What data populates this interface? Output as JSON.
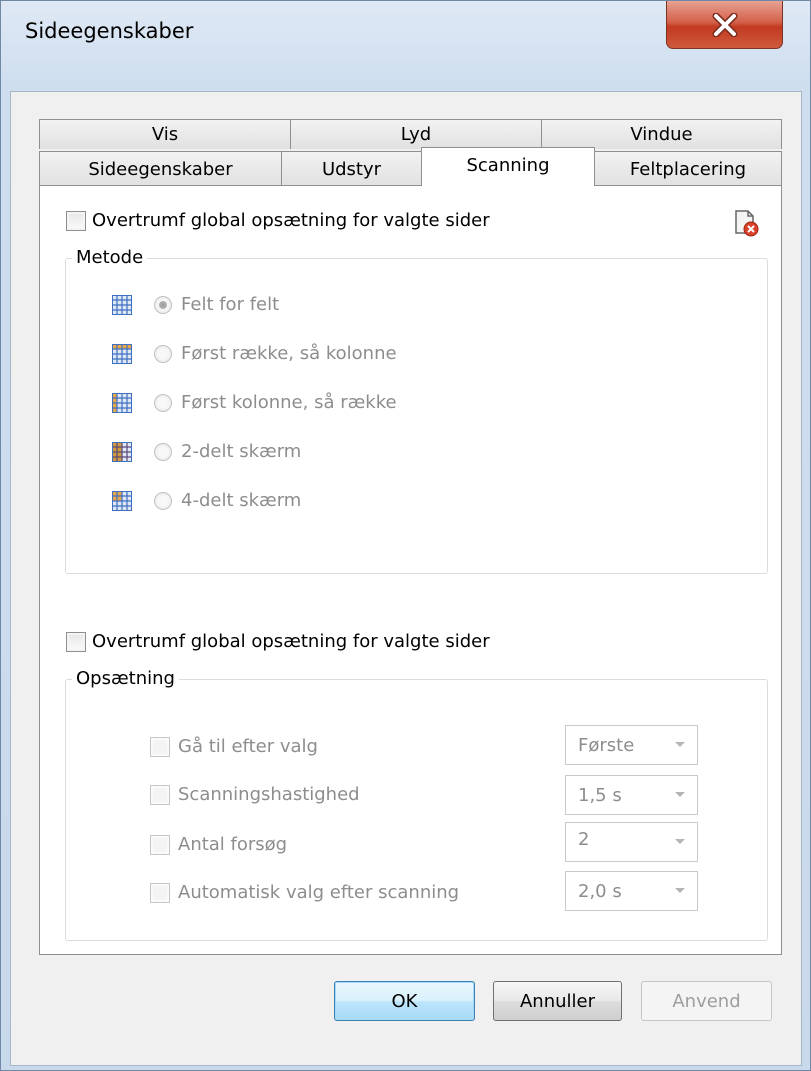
{
  "window": {
    "title": "Sideegenskaber"
  },
  "tabs": {
    "row1": [
      {
        "label": "Vis"
      },
      {
        "label": "Lyd"
      },
      {
        "label": "Vindue"
      }
    ],
    "row2": [
      {
        "label": "Sideegenskaber"
      },
      {
        "label": "Udstyr"
      },
      {
        "label": "Scanning"
      },
      {
        "label": "Feltplacering"
      }
    ],
    "active": "Scanning"
  },
  "method_section": {
    "override_label": "Overtrumf global opsætning for valgte sider",
    "override_checked": false,
    "group_title": "Metode",
    "options": [
      {
        "label": "Felt for felt",
        "checked": true,
        "icon": "grid-blue-icon"
      },
      {
        "label": "Først række, så kolonne",
        "checked": false,
        "icon": "grid-row-icon"
      },
      {
        "label": "Først kolonne, så række",
        "checked": false,
        "icon": "grid-column-icon"
      },
      {
        "label": "2-delt skærm",
        "checked": false,
        "icon": "grid-split2-icon"
      },
      {
        "label": "4-delt skærm",
        "checked": false,
        "icon": "grid-split4-icon"
      }
    ]
  },
  "setup_section": {
    "override_label": "Overtrumf global opsætning for valgte sider",
    "override_checked": false,
    "group_title": "Opsætning",
    "settings": [
      {
        "label": "Gå til efter valg",
        "value": "Første"
      },
      {
        "label": "Scanningshastighed",
        "value": "1,5 s"
      },
      {
        "label": "Antal forsøg",
        "value": "2"
      },
      {
        "label": "Automatisk valg efter scanning",
        "value": "2,0 s"
      }
    ]
  },
  "buttons": {
    "ok": "OK",
    "cancel": "Annuller",
    "apply": "Anvend"
  },
  "colors": {
    "close_red": "#c23a21",
    "grid_blue": "#3f6fc0",
    "grid_orange": "#c98a2a",
    "disabled_text": "#8d8d8d"
  }
}
